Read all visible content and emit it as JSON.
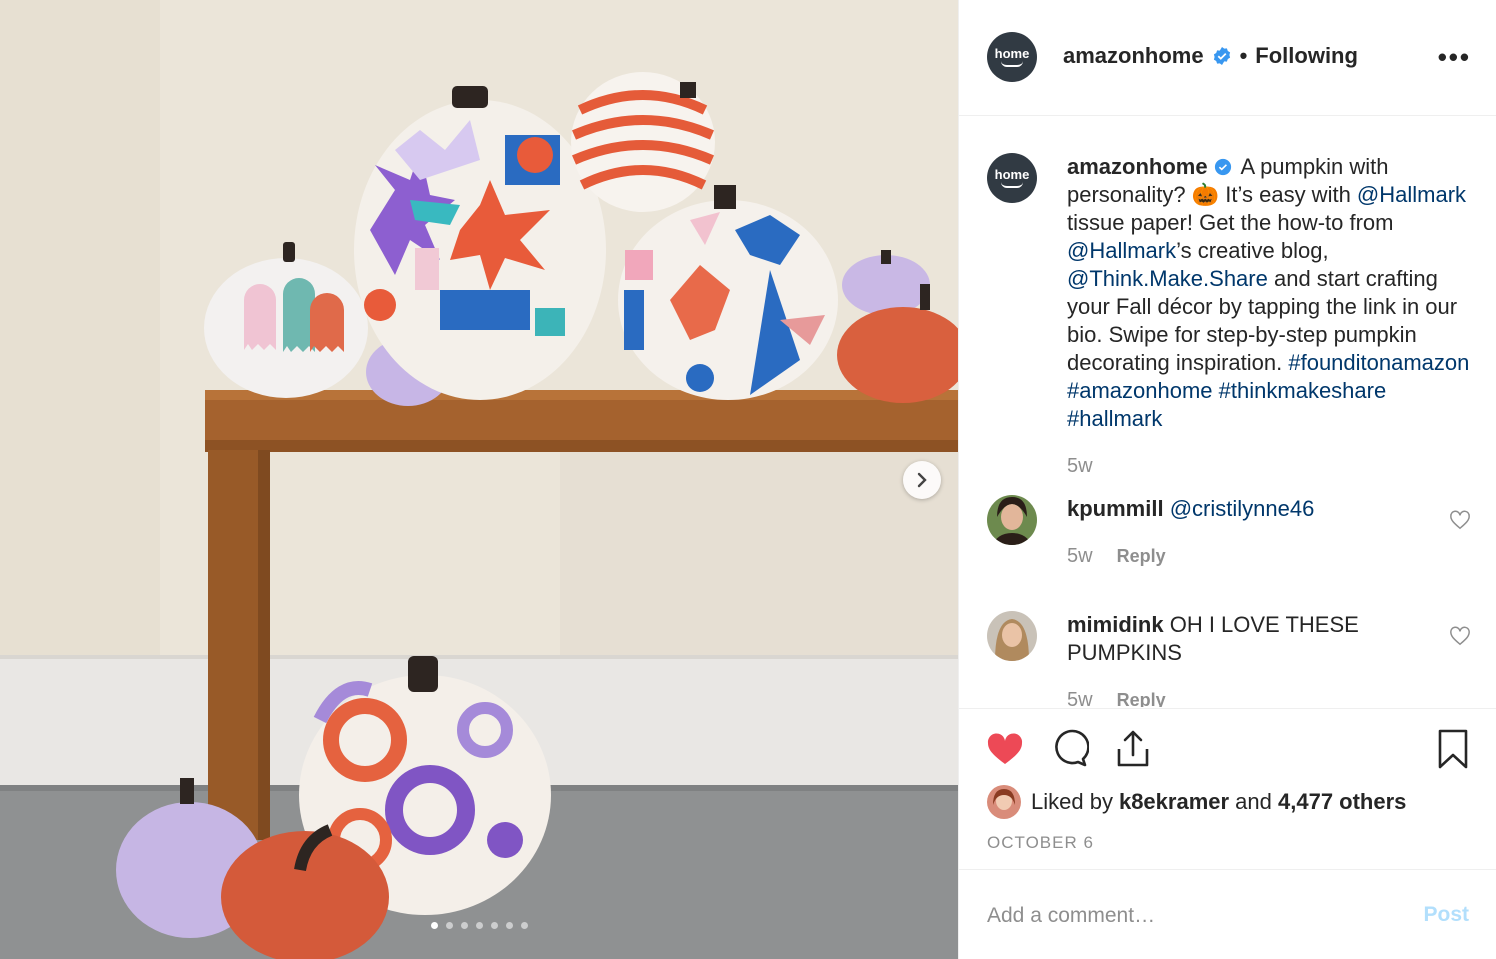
{
  "post": {
    "account": "amazonhome",
    "avatar_text": "home",
    "follow_status": "Following",
    "more_icon": "more-horizontal-icon",
    "photo_alt": "Decorated pumpkins on a wooden bench",
    "carousel": {
      "count": 7,
      "active_index": 0
    }
  },
  "caption": {
    "user": "amazonhome",
    "parts": [
      {
        "type": "text",
        "value": " A pumpkin with personality? "
      },
      {
        "type": "emoji",
        "value": "🎃"
      },
      {
        "type": "text",
        "value": "  It’s easy with "
      },
      {
        "type": "link",
        "value": "@Hallmark"
      },
      {
        "type": "text",
        "value": " tissue paper! Get the how-to from "
      },
      {
        "type": "link",
        "value": "@Hallmark"
      },
      {
        "type": "text",
        "value": "’s creative blog, "
      },
      {
        "type": "link",
        "value": "@Think.Make.Share"
      },
      {
        "type": "text",
        "value": " and start crafting your Fall décor by tapping the link in our bio. Swipe for step-by-step pumpkin decorating inspiration. "
      },
      {
        "type": "link",
        "value": "#founditonamazon"
      },
      {
        "type": "text",
        "value": " "
      },
      {
        "type": "link",
        "value": "#amazonhome"
      },
      {
        "type": "text",
        "value": " "
      },
      {
        "type": "link",
        "value": "#thinkmakeshare"
      },
      {
        "type": "text",
        "value": " "
      },
      {
        "type": "link",
        "value": "#hallmark"
      }
    ],
    "time": "5w"
  },
  "comments": [
    {
      "user": "kpummill",
      "mention": "@cristilynne46",
      "text": "",
      "time": "5w",
      "reply": "Reply"
    },
    {
      "user": "mimidink",
      "mention": "",
      "text": "OH I LOVE THESE PUMPKINS",
      "time": "5w",
      "reply": "Reply"
    }
  ],
  "likes": {
    "prefix": "Liked by ",
    "user": "k8ekramer",
    "middle": " and ",
    "others": "4,477 others",
    "liked": true
  },
  "date": "OCTOBER 6",
  "add_comment": {
    "placeholder": "Add a comment…",
    "post_label": "Post"
  },
  "colors": {
    "link": "#00376b",
    "like_red": "#ed4956",
    "verified_blue": "#3897f0",
    "post_disabled": "#b2dffc"
  }
}
